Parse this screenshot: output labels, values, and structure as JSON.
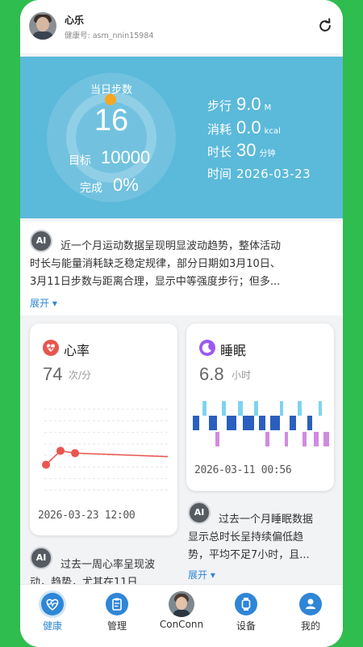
{
  "header": {
    "user_name": "心乐",
    "health_id": "健康号: asm_nnin15984",
    "refresh_icon": "refresh-icon"
  },
  "steps": {
    "label": "当日步数",
    "value": "16",
    "goal_label": "目标",
    "goal_value": "10000",
    "done_label": "完成",
    "done_value": "0%",
    "colors": {
      "panel": "#5bb9da",
      "dot": "#f6a623"
    }
  },
  "metrics": {
    "distance_label": "步行",
    "distance_value": "9.0",
    "distance_unit": "M",
    "calories_label": "消耗",
    "calories_value": "0.0",
    "calories_unit": "kcal",
    "duration_label": "时长",
    "duration_value": "30",
    "duration_unit": "分钟",
    "date_label": "时间",
    "date_value": "2026-03-23"
  },
  "ai_summary": {
    "badge": "AI",
    "line1": "近一个月运动数据呈现明显波动趋势，整体活动",
    "line2": "时长与能量消耗缺乏稳定规律，部分日期如3月10日、",
    "line3": "3月11日步数与距离合理，显示中等强度步行；但多...",
    "expand": "展开"
  },
  "heart_card": {
    "title": "心率",
    "value": "74",
    "unit": "次/分",
    "time": "2026-03-23 12:00",
    "icon": "heart-monitor-icon",
    "color": "#e8554e",
    "chart_data": {
      "type": "line",
      "x": [
        1,
        2,
        3,
        4
      ],
      "values": [
        62,
        74,
        72,
        69
      ],
      "ylim": [
        40,
        110
      ]
    }
  },
  "sleep_card": {
    "title": "睡眠",
    "value": "6.8",
    "unit": "小时",
    "time": "2026-03-11 00:56",
    "icon": "moon-icon",
    "color": "#9b59f0",
    "chart_data": {
      "type": "bar",
      "segment_colors": {
        "awake": "#7fd3f0",
        "light": "#2b5fbf",
        "deep": "#d08be0"
      }
    }
  },
  "heart_ai": {
    "badge": "AI",
    "line1": "过去一周心率呈现波",
    "line2": "动，趋势，尤其在11日"
  },
  "sleep_ai": {
    "badge": "AI",
    "line1": "过去一个月睡眠数据",
    "line2": "显示总时长呈持续偏低趋",
    "line3": "势，平均不足7小时，且...",
    "expand": "展开"
  },
  "nav": {
    "items": [
      {
        "label": "健康",
        "icon": "health-icon",
        "color": "#2f86d6"
      },
      {
        "label": "管理",
        "icon": "clipboard-icon",
        "color": "#333333"
      },
      {
        "label": "ConConn",
        "icon": "avatar-icon",
        "color": "#333333"
      },
      {
        "label": "设备",
        "icon": "watch-icon",
        "color": "#333333"
      },
      {
        "label": "我的",
        "icon": "profile-icon",
        "color": "#333333"
      }
    ]
  }
}
